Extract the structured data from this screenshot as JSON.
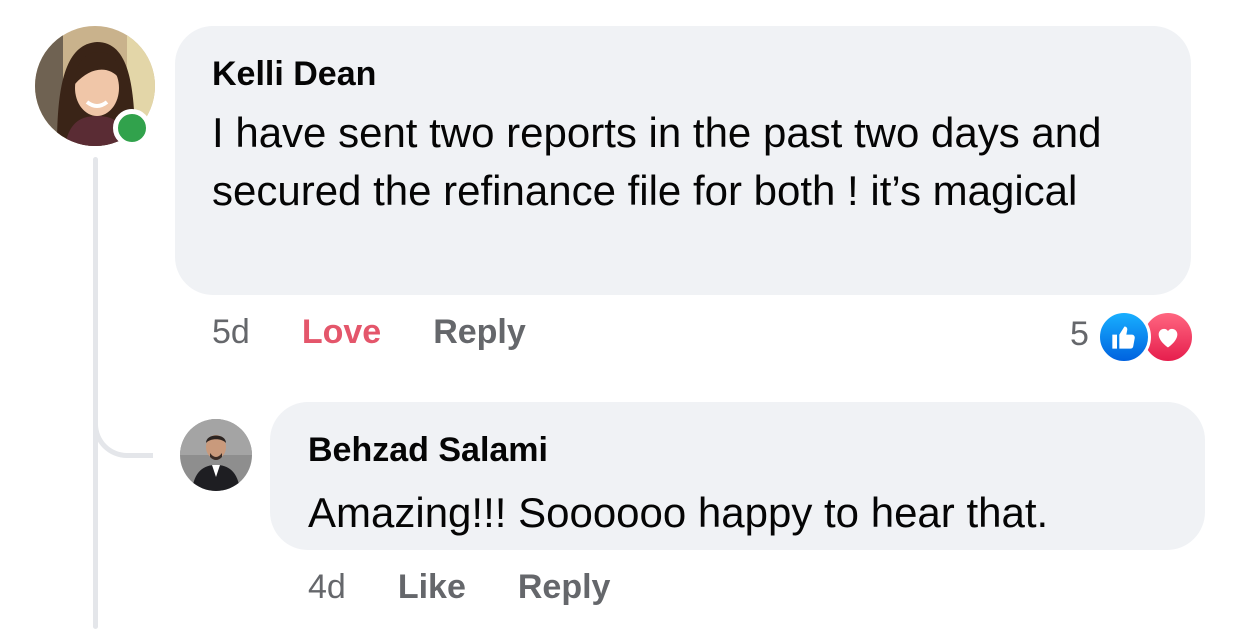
{
  "comments": [
    {
      "author": "Kelli Dean",
      "text": "I have sent two reports in the past two days and secured the refinance file for both ! it’s magical",
      "time": "5d",
      "reaction_action": "Love",
      "reply_label": "Reply",
      "reaction_count": "5",
      "reaction_icons": [
        "like-icon",
        "love-icon"
      ],
      "online": true
    },
    {
      "author": "Behzad Salami",
      "text": "Amazing!!! Soooooo happy to hear that.",
      "time": "4d",
      "reaction_action": "Like",
      "reply_label": "Reply"
    }
  ],
  "colors": {
    "bubble_bg": "#f0f2f5",
    "love_accent": "#e4566b",
    "online_green": "#31a24c",
    "meta_gray": "#65676b",
    "like_blue": "#1877f2"
  }
}
